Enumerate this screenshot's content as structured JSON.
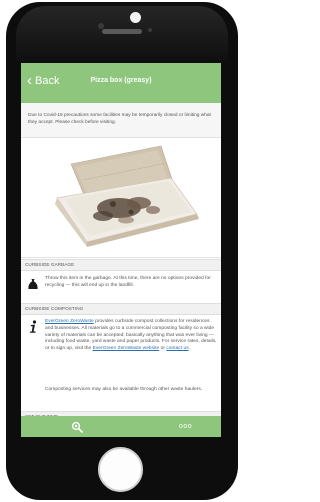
{
  "header": {
    "back_label": "Back",
    "title": "Pizza box (greasy)"
  },
  "notice": "Due to Covid-19 precautions some facilities may be temporarily closed or limiting what they accept. Please check before visiting.",
  "garbage": {
    "heading": "CURBSIDE GARBAGE",
    "text": "Throw this item in the garbage. At this time, there are no options provided for recycling — this will end up in the landfill."
  },
  "composting": {
    "heading": "CURBSIDE COMPOSTING",
    "link1": "EverGreen ZeroWaste",
    "text1": " provides curbside compost collections for residences and businesses. All materials go to a commercial composting facility so a wide variety of materials can be accepted; basically anything that was ever living — including food waste, yard waste and paper products. For service rates, details, or to sign up, visit the ",
    "link2": "EverGreen ZeroWaste website",
    "text2": " or ",
    "link3": "contact us",
    "text3": ".",
    "text4": "Composting services may also be available through other waste haulers."
  },
  "next_section": {
    "heading": "SET OUT TIME"
  },
  "footer": {
    "more_label": "ooo"
  },
  "icons": {
    "garbage": "garbage-bag-icon",
    "compost": "compost-info-icon",
    "search": "magnifier-icon",
    "more": "more-dots-icon"
  },
  "colors": {
    "accent": "#8dc67c",
    "link": "#2c6fb3"
  }
}
